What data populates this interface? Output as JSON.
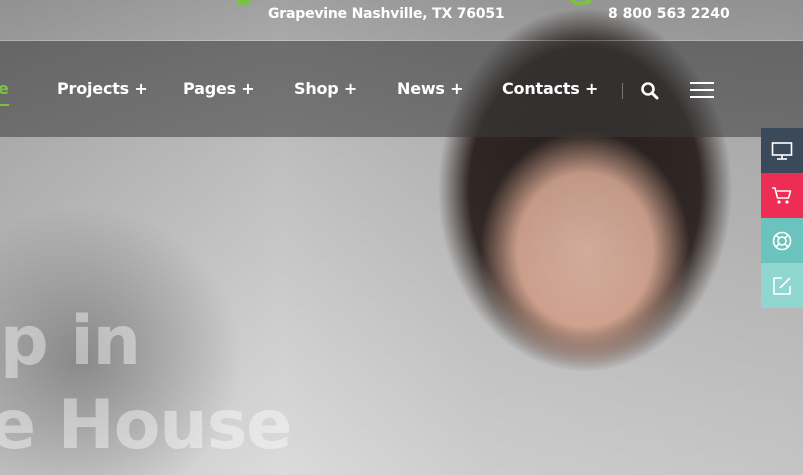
{
  "topbar": {
    "address": "Grapevine Nashville, TX 76051",
    "phone": "8 800 563 2240"
  },
  "nav": {
    "items": [
      {
        "label": "e",
        "active": true
      },
      {
        "label": "Projects +"
      },
      {
        "label": "Pages +"
      },
      {
        "label": "Shop +"
      },
      {
        "label": "News +"
      },
      {
        "label": "Contacts +"
      }
    ],
    "search_icon": "search-icon",
    "menu_icon": "hamburger-menu-icon"
  },
  "hero": {
    "line1": "p in",
    "line2": "e House"
  },
  "side_widget": {
    "buttons": [
      {
        "icon": "monitor-icon",
        "color": "#3a4a5a"
      },
      {
        "icon": "cart-icon",
        "color": "#ee2d55"
      },
      {
        "icon": "lifebuoy-icon",
        "color": "#6bc3bd"
      },
      {
        "icon": "edit-icon",
        "color": "#8fd6d0"
      }
    ]
  },
  "colors": {
    "accent": "#7cc242"
  }
}
